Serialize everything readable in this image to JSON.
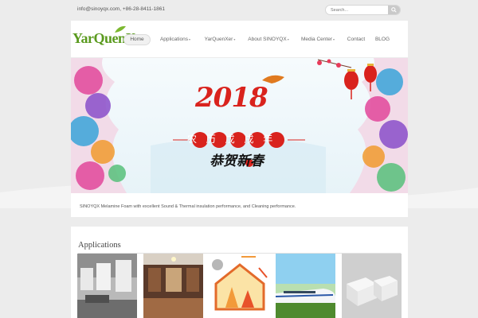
{
  "topbar": {
    "contact": "info@sinoyqx.com, +86-28-8411-1861",
    "search_placeholder": "Search..."
  },
  "header": {
    "logo_text": "YarQuenXer"
  },
  "nav": [
    {
      "label": "Home",
      "active": true,
      "dropdown": false
    },
    {
      "label": "Applications",
      "active": false,
      "dropdown": true
    },
    {
      "label": "YarQuenXer",
      "active": false,
      "dropdown": true
    },
    {
      "label": "About SINOYQX",
      "active": false,
      "dropdown": true
    },
    {
      "label": "Media Center",
      "active": false,
      "dropdown": true
    },
    {
      "label": "Contact",
      "active": false,
      "dropdown": false
    },
    {
      "label": "BLOG",
      "active": false,
      "dropdown": false
    }
  ],
  "banner": {
    "year": "2018",
    "headline": "农历戊戌年",
    "greeting": "恭贺新春"
  },
  "caption": "SINOYQX Melamine Foam with excellent Sound & Thermal insulation performance, and Cleaning performance.",
  "applications": {
    "title": "Applications",
    "items": [
      {
        "name": "ceiling-panels-photo"
      },
      {
        "name": "shop-interior-photo"
      },
      {
        "name": "thermal-house-diagram"
      },
      {
        "name": "high-speed-train-photo"
      },
      {
        "name": "foam-blocks-photo"
      }
    ]
  },
  "colors": {
    "accent_green": "#5a9a1e",
    "banner_red": "#d9231d",
    "page_bg": "#ececec"
  }
}
